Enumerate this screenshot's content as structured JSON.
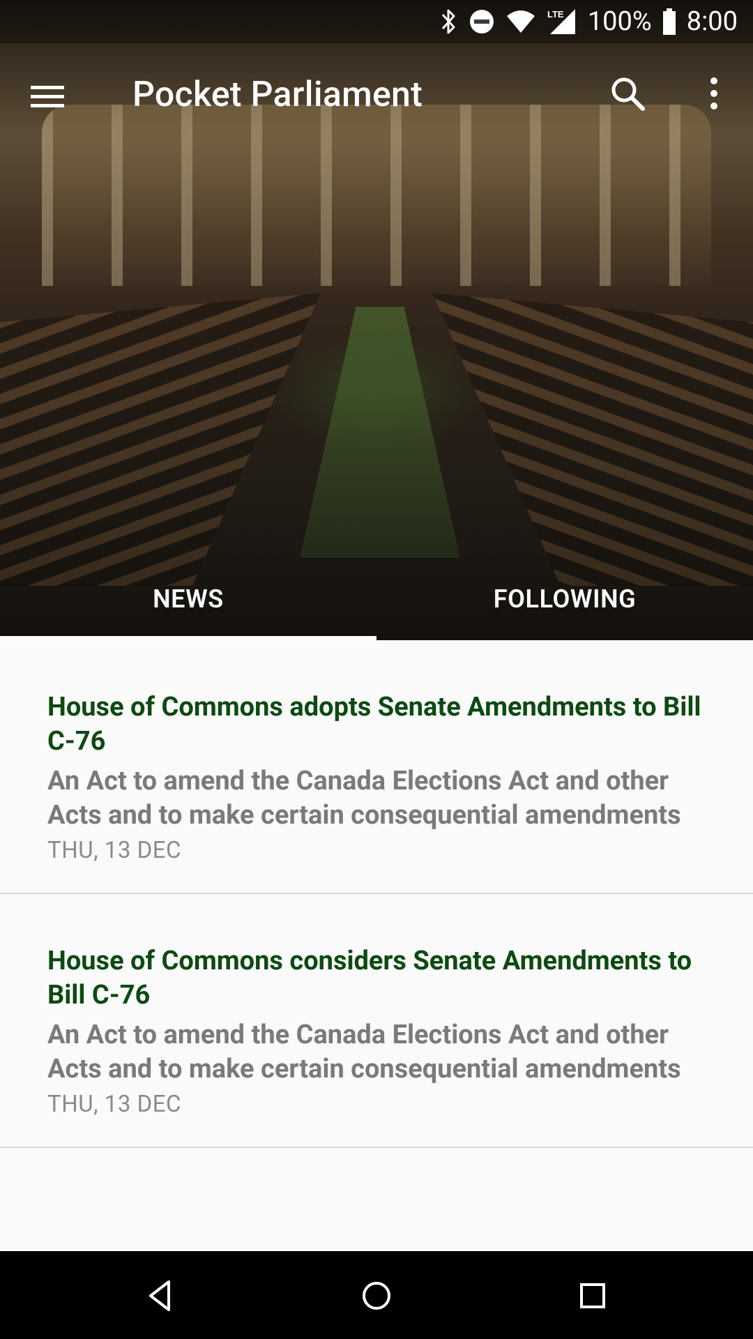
{
  "status_bar": {
    "battery_percent": "100%",
    "time": "8:00",
    "network": "LTE",
    "icons": [
      "bluetooth-icon",
      "do-not-disturb-icon",
      "wifi-icon",
      "lte-signal-icon",
      "battery-icon"
    ]
  },
  "app_bar": {
    "title": "Pocket Parliament",
    "icons": [
      "menu-icon",
      "search-icon",
      "more-vert-icon"
    ]
  },
  "hero": {
    "description": "House of Commons chamber photo"
  },
  "tabs": [
    {
      "label": "NEWS",
      "selected": true
    },
    {
      "label": "FOLLOWING",
      "selected": false
    }
  ],
  "news": [
    {
      "headline": "House of Commons adopts Senate Amendments to Bill C-76",
      "description": "An Act to amend the Canada Elections Act and other Acts and to make certain consequential amendments",
      "date": "THU, 13 DEC"
    },
    {
      "headline": "House of Commons considers Senate Amendments to Bill C-76",
      "description": "An Act to amend the Canada Elections Act and other Acts and to make certain consequential amendments",
      "date": "THU, 13 DEC"
    }
  ],
  "nav_bar": {
    "icons": [
      "back-icon",
      "home-icon",
      "recents-icon"
    ]
  },
  "colors": {
    "headline": "#0d4a12",
    "description": "#7a7a7a",
    "date": "#8a8a8a",
    "background": "#fafafa"
  }
}
